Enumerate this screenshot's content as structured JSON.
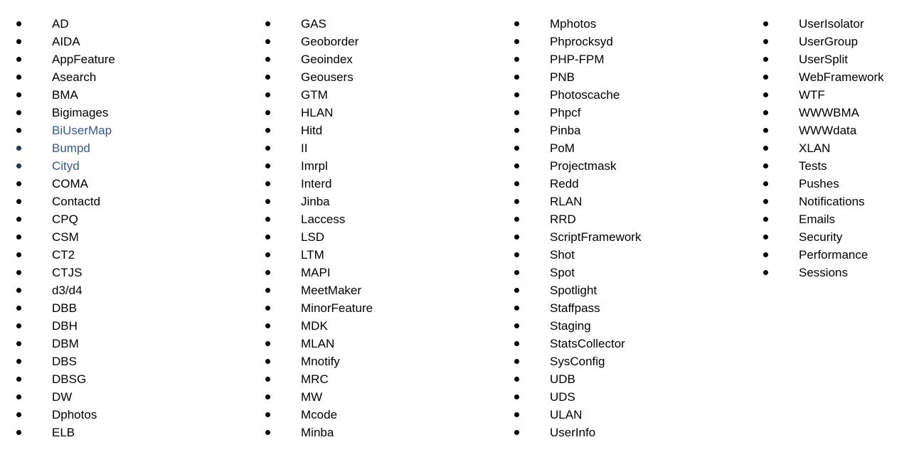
{
  "colors": {
    "text": "#000000",
    "accent_text": "#36598c",
    "accent_bullet": "#1d3557",
    "background": "#ffffff"
  },
  "columns": [
    {
      "name": "column-1",
      "items": [
        {
          "label": "AD",
          "accent": false,
          "accent_bullet": false
        },
        {
          "label": "AIDA",
          "accent": false,
          "accent_bullet": false
        },
        {
          "label": "AppFeature",
          "accent": false,
          "accent_bullet": false
        },
        {
          "label": "Asearch",
          "accent": false,
          "accent_bullet": false
        },
        {
          "label": "BMA",
          "accent": false,
          "accent_bullet": false
        },
        {
          "label": "Bigimages",
          "accent": false,
          "accent_bullet": false
        },
        {
          "label": "BiUserMap",
          "accent": true,
          "accent_bullet": false
        },
        {
          "label": "Bumpd",
          "accent": true,
          "accent_bullet": true
        },
        {
          "label": "Cityd",
          "accent": true,
          "accent_bullet": true
        },
        {
          "label": "COMA",
          "accent": false,
          "accent_bullet": false
        },
        {
          "label": "Contactd",
          "accent": false,
          "accent_bullet": false
        },
        {
          "label": "CPQ",
          "accent": false,
          "accent_bullet": false
        },
        {
          "label": "CSM",
          "accent": false,
          "accent_bullet": false
        },
        {
          "label": "CT2",
          "accent": false,
          "accent_bullet": false
        },
        {
          "label": "CTJS",
          "accent": false,
          "accent_bullet": false
        },
        {
          "label": "d3/d4",
          "accent": false,
          "accent_bullet": false
        },
        {
          "label": "DBB",
          "accent": false,
          "accent_bullet": false
        },
        {
          "label": "DBH",
          "accent": false,
          "accent_bullet": false
        },
        {
          "label": "DBM",
          "accent": false,
          "accent_bullet": false
        },
        {
          "label": "DBS",
          "accent": false,
          "accent_bullet": false
        },
        {
          "label": "DBSG",
          "accent": false,
          "accent_bullet": false
        },
        {
          "label": "DW",
          "accent": false,
          "accent_bullet": false
        },
        {
          "label": "Dphotos",
          "accent": false,
          "accent_bullet": false
        },
        {
          "label": "ELB",
          "accent": false,
          "accent_bullet": false
        }
      ]
    },
    {
      "name": "column-2",
      "items": [
        {
          "label": "GAS",
          "accent": false,
          "accent_bullet": false
        },
        {
          "label": "Geoborder",
          "accent": false,
          "accent_bullet": false
        },
        {
          "label": "Geoindex",
          "accent": false,
          "accent_bullet": false
        },
        {
          "label": "Geousers",
          "accent": false,
          "accent_bullet": false
        },
        {
          "label": "GTM",
          "accent": false,
          "accent_bullet": false
        },
        {
          "label": "HLAN",
          "accent": false,
          "accent_bullet": false
        },
        {
          "label": "Hitd",
          "accent": false,
          "accent_bullet": false
        },
        {
          "label": "II",
          "accent": false,
          "accent_bullet": false
        },
        {
          "label": "Imrpl",
          "accent": false,
          "accent_bullet": false
        },
        {
          "label": "Interd",
          "accent": false,
          "accent_bullet": false
        },
        {
          "label": "Jinba",
          "accent": false,
          "accent_bullet": false
        },
        {
          "label": "Laccess",
          "accent": false,
          "accent_bullet": false
        },
        {
          "label": "LSD",
          "accent": false,
          "accent_bullet": false
        },
        {
          "label": "LTM",
          "accent": false,
          "accent_bullet": false
        },
        {
          "label": "MAPI",
          "accent": false,
          "accent_bullet": false
        },
        {
          "label": "MeetMaker",
          "accent": false,
          "accent_bullet": false
        },
        {
          "label": "MinorFeature",
          "accent": false,
          "accent_bullet": false
        },
        {
          "label": "MDK",
          "accent": false,
          "accent_bullet": false
        },
        {
          "label": "MLAN",
          "accent": false,
          "accent_bullet": false
        },
        {
          "label": "Mnotify",
          "accent": false,
          "accent_bullet": false
        },
        {
          "label": "MRC",
          "accent": false,
          "accent_bullet": false
        },
        {
          "label": "MW",
          "accent": false,
          "accent_bullet": false
        },
        {
          "label": "Mcode",
          "accent": false,
          "accent_bullet": false
        },
        {
          "label": "Minba",
          "accent": false,
          "accent_bullet": false
        }
      ]
    },
    {
      "name": "column-3",
      "items": [
        {
          "label": "Mphotos",
          "accent": false,
          "accent_bullet": false
        },
        {
          "label": "Phprocksyd",
          "accent": false,
          "accent_bullet": false
        },
        {
          "label": "PHP-FPM",
          "accent": false,
          "accent_bullet": false
        },
        {
          "label": "PNB",
          "accent": false,
          "accent_bullet": false
        },
        {
          "label": "Photoscache",
          "accent": false,
          "accent_bullet": false
        },
        {
          "label": "Phpcf",
          "accent": false,
          "accent_bullet": false
        },
        {
          "label": "Pinba",
          "accent": false,
          "accent_bullet": false
        },
        {
          "label": "PoM",
          "accent": false,
          "accent_bullet": false
        },
        {
          "label": "Projectmask",
          "accent": false,
          "accent_bullet": false
        },
        {
          "label": "Redd",
          "accent": false,
          "accent_bullet": false
        },
        {
          "label": "RLAN",
          "accent": false,
          "accent_bullet": false
        },
        {
          "label": "RRD",
          "accent": false,
          "accent_bullet": false
        },
        {
          "label": "ScriptFramework",
          "accent": false,
          "accent_bullet": false
        },
        {
          "label": "Shot",
          "accent": false,
          "accent_bullet": false
        },
        {
          "label": "Spot",
          "accent": false,
          "accent_bullet": false
        },
        {
          "label": "Spotlight",
          "accent": false,
          "accent_bullet": false
        },
        {
          "label": "Staffpass",
          "accent": false,
          "accent_bullet": false
        },
        {
          "label": "Staging",
          "accent": false,
          "accent_bullet": false
        },
        {
          "label": "StatsCollector",
          "accent": false,
          "accent_bullet": false
        },
        {
          "label": "SysConfig",
          "accent": false,
          "accent_bullet": false
        },
        {
          "label": "UDB",
          "accent": false,
          "accent_bullet": false
        },
        {
          "label": "UDS",
          "accent": false,
          "accent_bullet": false
        },
        {
          "label": "ULAN",
          "accent": false,
          "accent_bullet": false
        },
        {
          "label": "UserInfo",
          "accent": false,
          "accent_bullet": false
        }
      ]
    },
    {
      "name": "column-4",
      "items": [
        {
          "label": "UserIsolator",
          "accent": false,
          "accent_bullet": false
        },
        {
          "label": "UserGroup",
          "accent": false,
          "accent_bullet": false
        },
        {
          "label": "UserSplit",
          "accent": false,
          "accent_bullet": false
        },
        {
          "label": "WebFramework",
          "accent": false,
          "accent_bullet": false
        },
        {
          "label": "WTF",
          "accent": false,
          "accent_bullet": false
        },
        {
          "label": "WWWBMA",
          "accent": false,
          "accent_bullet": false
        },
        {
          "label": "WWWdata",
          "accent": false,
          "accent_bullet": false
        },
        {
          "label": "XLAN",
          "accent": false,
          "accent_bullet": false
        },
        {
          "label": "Tests",
          "accent": false,
          "accent_bullet": false
        },
        {
          "label": "Pushes",
          "accent": false,
          "accent_bullet": false
        },
        {
          "label": "Notifications",
          "accent": false,
          "accent_bullet": false
        },
        {
          "label": "Emails",
          "accent": false,
          "accent_bullet": false
        },
        {
          "label": "Security",
          "accent": false,
          "accent_bullet": false
        },
        {
          "label": "Performance",
          "accent": false,
          "accent_bullet": false
        },
        {
          "label": "Sessions",
          "accent": false,
          "accent_bullet": false
        }
      ]
    }
  ]
}
